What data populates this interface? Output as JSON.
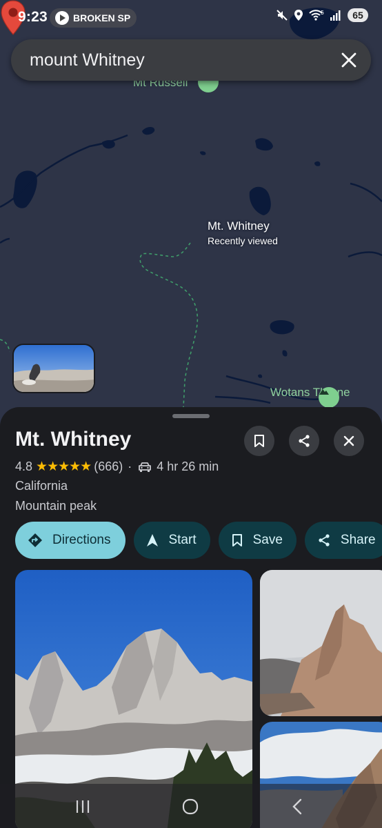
{
  "status_bar": {
    "time": "9:23",
    "media_text": "BROKEN SP",
    "battery": "65",
    "network": "5"
  },
  "search": {
    "query": "mount Whitney"
  },
  "map": {
    "labels": {
      "mt_russell": "Mt Russell",
      "wotans_throne": "Wotans Throne"
    },
    "pin": {
      "title": "Mt. Whitney",
      "subtitle": "Recently viewed"
    }
  },
  "place": {
    "title": "Mt. Whitney",
    "rating": "4.8",
    "stars": "★★★★★",
    "review_count": "(666)",
    "separator": "·",
    "drive_time": "4 hr 26 min",
    "region": "California",
    "category": "Mountain peak"
  },
  "actions": {
    "directions": "Directions",
    "start": "Start",
    "save": "Save",
    "share": "Share"
  },
  "colors": {
    "map_background": "#2e3447",
    "water": "#0b1a3a",
    "trail": "#3f9c6a",
    "primary_chip": "#7ecfdc",
    "secondary_chip": "#0f3b44",
    "star": "#fbbc04",
    "pin": "#e4493c"
  }
}
